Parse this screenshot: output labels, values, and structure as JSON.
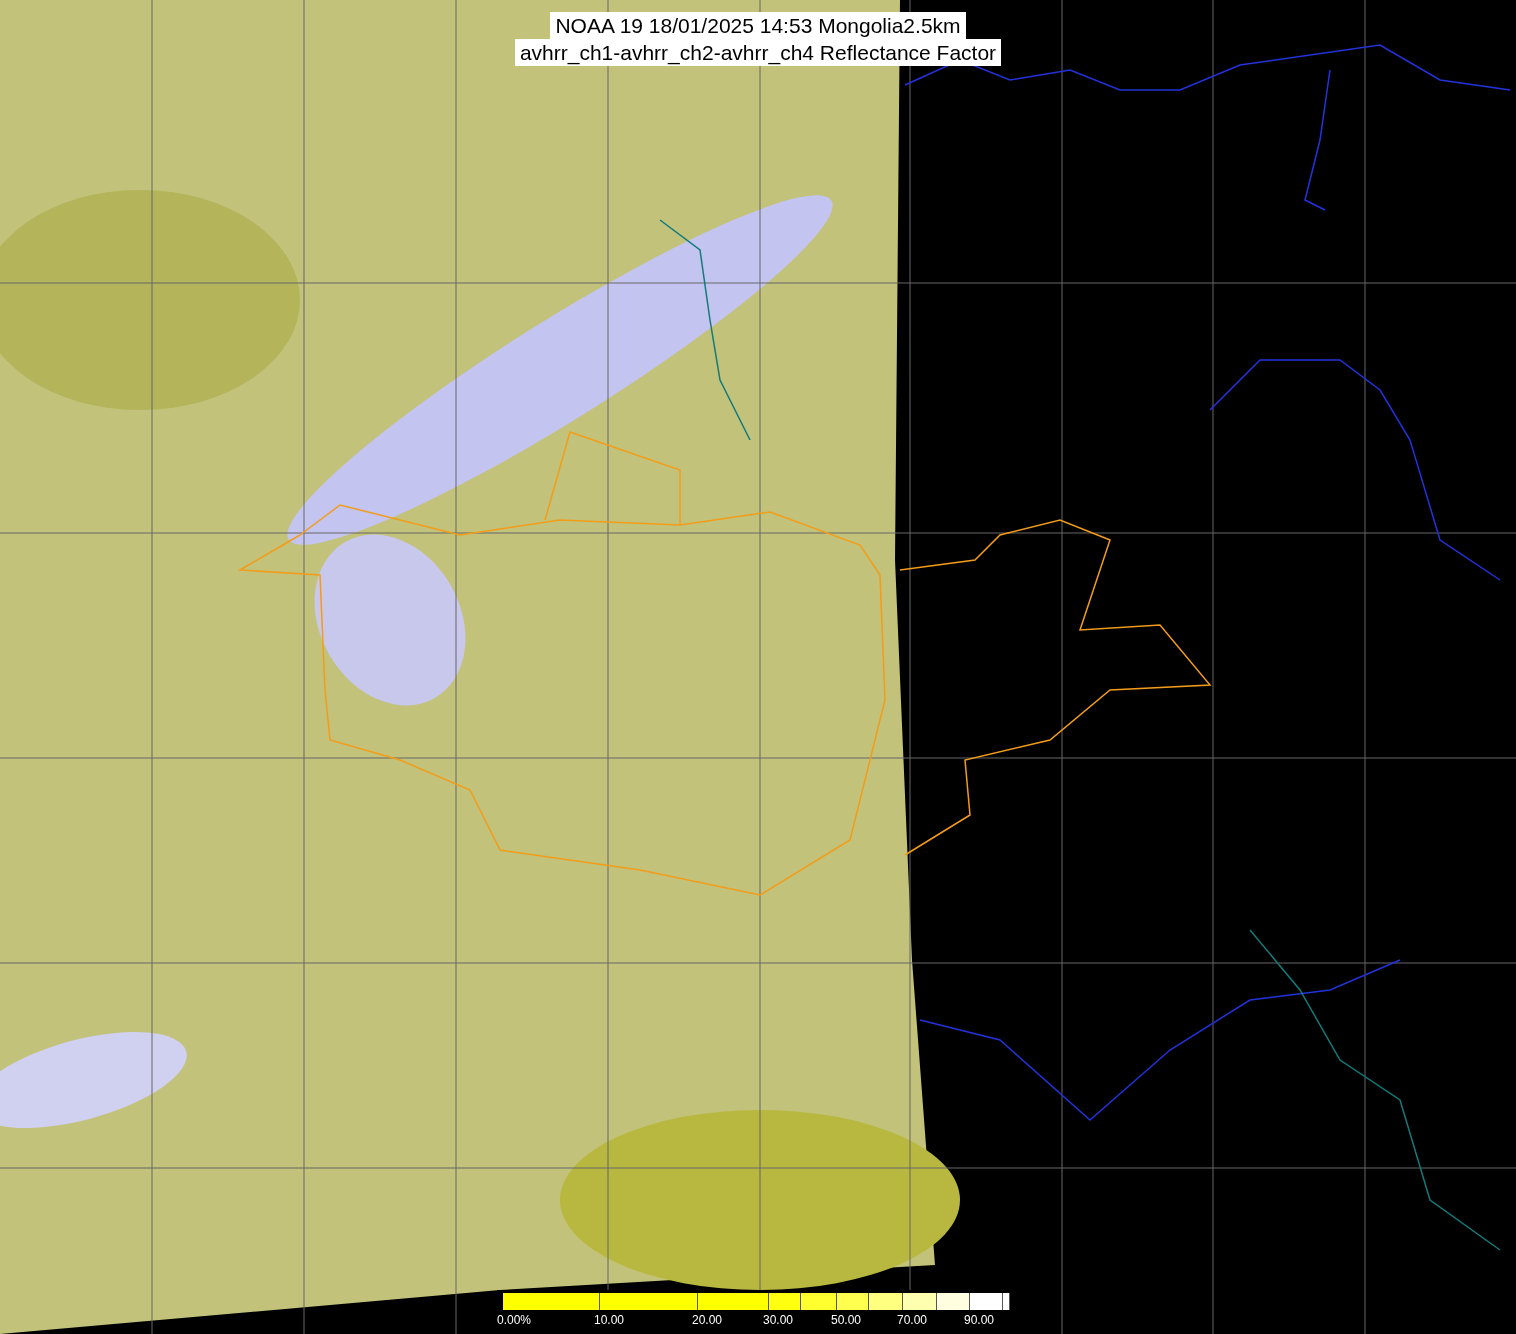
{
  "title_lines": [
    "NOAA 19 18/01/2025 14:53 Mongolia2.5km",
    "avhrr_ch1-avhrr_ch2-avhrr_ch4 Reflectance Factor"
  ],
  "colorbar": {
    "segments": [
      {
        "color": "#ffff00",
        "label": "0.00%"
      },
      {
        "color": "#ffff00",
        "label": "10.00"
      },
      {
        "color": "#ffff00",
        "label": "20.00"
      },
      {
        "color": "#ffff10",
        "label": "30.00"
      },
      {
        "color": "#ffff30"
      },
      {
        "color": "#ffff50",
        "label": "50.00"
      },
      {
        "color": "#ffff80"
      },
      {
        "color": "#ffffb0",
        "label": "70.00"
      },
      {
        "color": "#ffffe0"
      },
      {
        "color": "#ffffff",
        "label": "90.00"
      },
      {
        "color": "#ffffff"
      }
    ]
  }
}
